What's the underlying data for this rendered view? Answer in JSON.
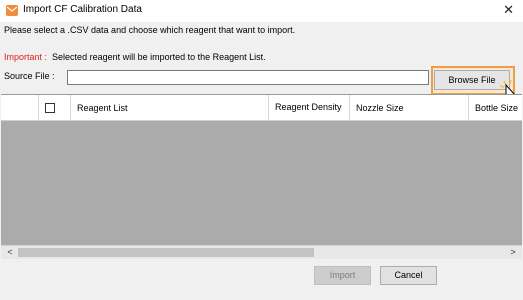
{
  "window": {
    "title": "Import CF Calibration Data",
    "app_icon": "envelope-icon",
    "close_glyph": "✕"
  },
  "instruction": "Please select a .CSV data and choose which reagent that want to import.",
  "important": {
    "label": "Important :",
    "text": "Selected reagent will be imported to the Reagent List.",
    "label_color": "#e02020"
  },
  "source": {
    "label": "Source File   :",
    "value": "",
    "browse_label": "Browse File"
  },
  "table": {
    "columns": [
      "",
      "",
      "Reagent List",
      "Reagent Density",
      "Nozzle Size",
      "Bottle Size"
    ],
    "rows": []
  },
  "scroll": {
    "left_arrow": "<",
    "right_arrow": ">"
  },
  "buttons": {
    "import_label": "Import",
    "import_enabled": false,
    "cancel_label": "Cancel"
  },
  "colors": {
    "highlight": "#e8a04a",
    "grid_background": "#ababab"
  }
}
